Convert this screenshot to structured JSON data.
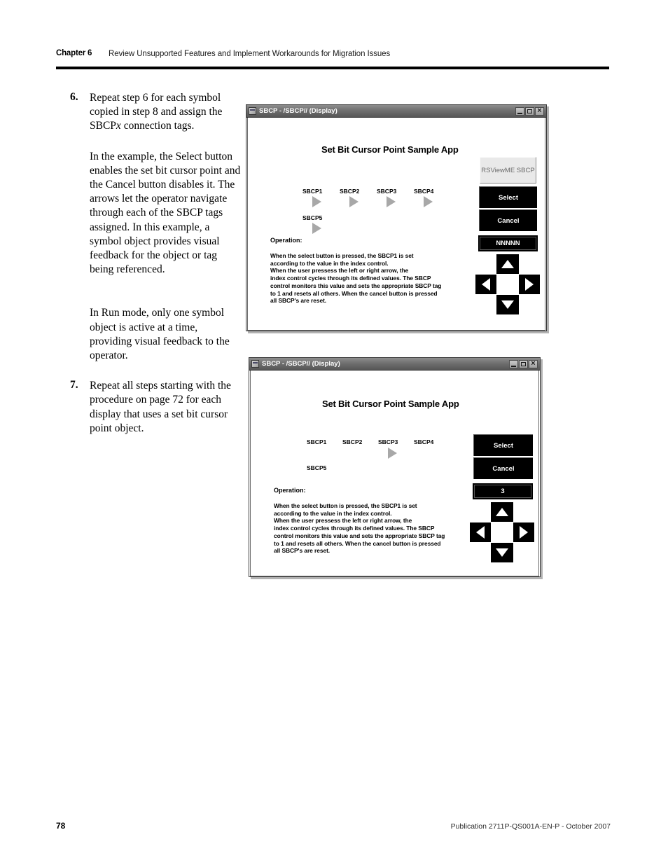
{
  "header": {
    "chapter_label": "Chapter 6",
    "chapter_title": "Review Unsupported Features and Implement Workarounds for Migration Issues"
  },
  "steps": {
    "step6": {
      "number": "6.",
      "text": "Repeat step 6 for each symbol copied in step 8 and assign the SBCP",
      "italic_suffix": "x",
      "text_end": " connection tags.",
      "para2": "In the example, the Select button enables the set bit cursor point and the Cancel button disables it. The arrows let the operator navigate through each of the SBCP tags assigned. In this example, a symbol object provides visual feedback for the object or tag being referenced.",
      "para3": "In Run mode, only one symbol object is active at a time, providing visual feedback to the operator."
    },
    "step7": {
      "number": "7.",
      "text": "Repeat all steps starting with the procedure on page 72 for each display that uses a set bit cursor point object."
    }
  },
  "window1": {
    "titlebar": {
      "title": "SBCP - /SBCP// (Display)",
      "minimize_label": "Minimize",
      "maximize_label": "Maximize",
      "close_label": "×"
    },
    "app_title": "Set Bit Cursor Point Sample App",
    "tags": [
      {
        "label": "SBCP1",
        "has_symbol": true
      },
      {
        "label": "SBCP2",
        "has_symbol": true
      },
      {
        "label": "SBCP3",
        "has_symbol": true
      },
      {
        "label": "SBCP4",
        "has_symbol": true
      },
      {
        "label": "SBCP5",
        "has_symbol": true
      }
    ],
    "operation_label": "Operation:",
    "operation_text": "When the select button is pressed, the SBCP1 is set\naccording to the value in the index control.\nWhen the user pressess the left or right arrow, the\nindex control cycles through its defined values. The SBCP\ncontrol monitors this value and sets the appropriate SBCP tag\nto 1 and resets all others. When the cancel button is pressed\nall SBCP's are reset.",
    "symbol_panel": "RSViewME SBCP",
    "select_button": "Select",
    "cancel_button": "Cancel",
    "index_value": "NNNNN",
    "arrows": {
      "up": "up-arrow",
      "down": "down-arrow",
      "left": "left-arrow",
      "right": "right-arrow"
    }
  },
  "window2": {
    "titlebar": {
      "title": "SBCP - /SBCP// (Display)",
      "minimize_label": "Minimize",
      "maximize_label": "Maximize",
      "close_label": "×"
    },
    "app_title": "Set Bit Cursor Point Sample App",
    "tags": [
      {
        "label": "SBCP1",
        "has_symbol": false
      },
      {
        "label": "SBCP2",
        "has_symbol": false
      },
      {
        "label": "SBCP3",
        "has_symbol": true
      },
      {
        "label": "SBCP4",
        "has_symbol": false
      },
      {
        "label": "SBCP5",
        "has_symbol": false
      }
    ],
    "operation_label": "Operation:",
    "operation_text": "When the select button is pressed, the SBCP1 is set\naccording to the value in the index control.\nWhen the user pressess the left or right arrow, the\nindex control cycles through its defined values. The SBCP\ncontrol monitors this value and sets the appropriate SBCP tag\nto 1 and resets all others. When the cancel button is pressed\nall SBCP's are reset.",
    "select_button": "Select",
    "cancel_button": "Cancel",
    "index_value": "3",
    "arrows": {
      "up": "up-arrow",
      "down": "down-arrow",
      "left": "left-arrow",
      "right": "right-arrow"
    }
  },
  "footer": {
    "page_number": "78",
    "publication": "Publication 2711P-QS001A-EN-P - October 2007"
  },
  "colors": {
    "page_background": "#ffffff",
    "text": "#000000",
    "symbol_gray": "#a8a8a8",
    "button_black": "#000000",
    "titlebar_gray": "#6f6f6f"
  }
}
